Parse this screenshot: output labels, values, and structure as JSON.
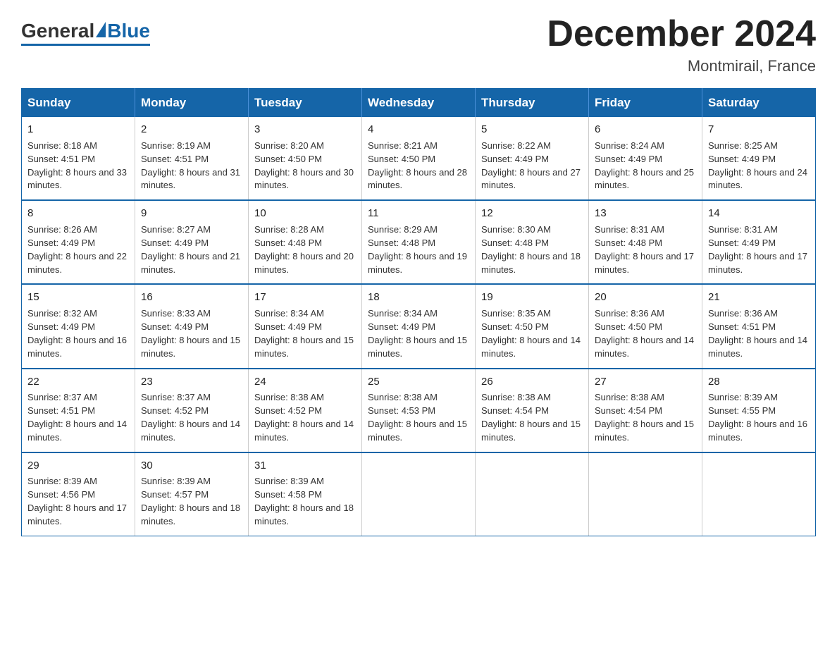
{
  "header": {
    "logo_general": "General",
    "logo_blue": "Blue",
    "month_title": "December 2024",
    "location": "Montmirail, France"
  },
  "weekdays": [
    "Sunday",
    "Monday",
    "Tuesday",
    "Wednesday",
    "Thursday",
    "Friday",
    "Saturday"
  ],
  "weeks": [
    [
      {
        "day": "1",
        "sunrise": "8:18 AM",
        "sunset": "4:51 PM",
        "daylight": "8 hours and 33 minutes."
      },
      {
        "day": "2",
        "sunrise": "8:19 AM",
        "sunset": "4:51 PM",
        "daylight": "8 hours and 31 minutes."
      },
      {
        "day": "3",
        "sunrise": "8:20 AM",
        "sunset": "4:50 PM",
        "daylight": "8 hours and 30 minutes."
      },
      {
        "day": "4",
        "sunrise": "8:21 AM",
        "sunset": "4:50 PM",
        "daylight": "8 hours and 28 minutes."
      },
      {
        "day": "5",
        "sunrise": "8:22 AM",
        "sunset": "4:49 PM",
        "daylight": "8 hours and 27 minutes."
      },
      {
        "day": "6",
        "sunrise": "8:24 AM",
        "sunset": "4:49 PM",
        "daylight": "8 hours and 25 minutes."
      },
      {
        "day": "7",
        "sunrise": "8:25 AM",
        "sunset": "4:49 PM",
        "daylight": "8 hours and 24 minutes."
      }
    ],
    [
      {
        "day": "8",
        "sunrise": "8:26 AM",
        "sunset": "4:49 PM",
        "daylight": "8 hours and 22 minutes."
      },
      {
        "day": "9",
        "sunrise": "8:27 AM",
        "sunset": "4:49 PM",
        "daylight": "8 hours and 21 minutes."
      },
      {
        "day": "10",
        "sunrise": "8:28 AM",
        "sunset": "4:48 PM",
        "daylight": "8 hours and 20 minutes."
      },
      {
        "day": "11",
        "sunrise": "8:29 AM",
        "sunset": "4:48 PM",
        "daylight": "8 hours and 19 minutes."
      },
      {
        "day": "12",
        "sunrise": "8:30 AM",
        "sunset": "4:48 PM",
        "daylight": "8 hours and 18 minutes."
      },
      {
        "day": "13",
        "sunrise": "8:31 AM",
        "sunset": "4:48 PM",
        "daylight": "8 hours and 17 minutes."
      },
      {
        "day": "14",
        "sunrise": "8:31 AM",
        "sunset": "4:49 PM",
        "daylight": "8 hours and 17 minutes."
      }
    ],
    [
      {
        "day": "15",
        "sunrise": "8:32 AM",
        "sunset": "4:49 PM",
        "daylight": "8 hours and 16 minutes."
      },
      {
        "day": "16",
        "sunrise": "8:33 AM",
        "sunset": "4:49 PM",
        "daylight": "8 hours and 15 minutes."
      },
      {
        "day": "17",
        "sunrise": "8:34 AM",
        "sunset": "4:49 PM",
        "daylight": "8 hours and 15 minutes."
      },
      {
        "day": "18",
        "sunrise": "8:34 AM",
        "sunset": "4:49 PM",
        "daylight": "8 hours and 15 minutes."
      },
      {
        "day": "19",
        "sunrise": "8:35 AM",
        "sunset": "4:50 PM",
        "daylight": "8 hours and 14 minutes."
      },
      {
        "day": "20",
        "sunrise": "8:36 AM",
        "sunset": "4:50 PM",
        "daylight": "8 hours and 14 minutes."
      },
      {
        "day": "21",
        "sunrise": "8:36 AM",
        "sunset": "4:51 PM",
        "daylight": "8 hours and 14 minutes."
      }
    ],
    [
      {
        "day": "22",
        "sunrise": "8:37 AM",
        "sunset": "4:51 PM",
        "daylight": "8 hours and 14 minutes."
      },
      {
        "day": "23",
        "sunrise": "8:37 AM",
        "sunset": "4:52 PM",
        "daylight": "8 hours and 14 minutes."
      },
      {
        "day": "24",
        "sunrise": "8:38 AM",
        "sunset": "4:52 PM",
        "daylight": "8 hours and 14 minutes."
      },
      {
        "day": "25",
        "sunrise": "8:38 AM",
        "sunset": "4:53 PM",
        "daylight": "8 hours and 15 minutes."
      },
      {
        "day": "26",
        "sunrise": "8:38 AM",
        "sunset": "4:54 PM",
        "daylight": "8 hours and 15 minutes."
      },
      {
        "day": "27",
        "sunrise": "8:38 AM",
        "sunset": "4:54 PM",
        "daylight": "8 hours and 15 minutes."
      },
      {
        "day": "28",
        "sunrise": "8:39 AM",
        "sunset": "4:55 PM",
        "daylight": "8 hours and 16 minutes."
      }
    ],
    [
      {
        "day": "29",
        "sunrise": "8:39 AM",
        "sunset": "4:56 PM",
        "daylight": "8 hours and 17 minutes."
      },
      {
        "day": "30",
        "sunrise": "8:39 AM",
        "sunset": "4:57 PM",
        "daylight": "8 hours and 18 minutes."
      },
      {
        "day": "31",
        "sunrise": "8:39 AM",
        "sunset": "4:58 PM",
        "daylight": "8 hours and 18 minutes."
      },
      null,
      null,
      null,
      null
    ]
  ],
  "labels": {
    "sunrise": "Sunrise:",
    "sunset": "Sunset:",
    "daylight": "Daylight:"
  }
}
